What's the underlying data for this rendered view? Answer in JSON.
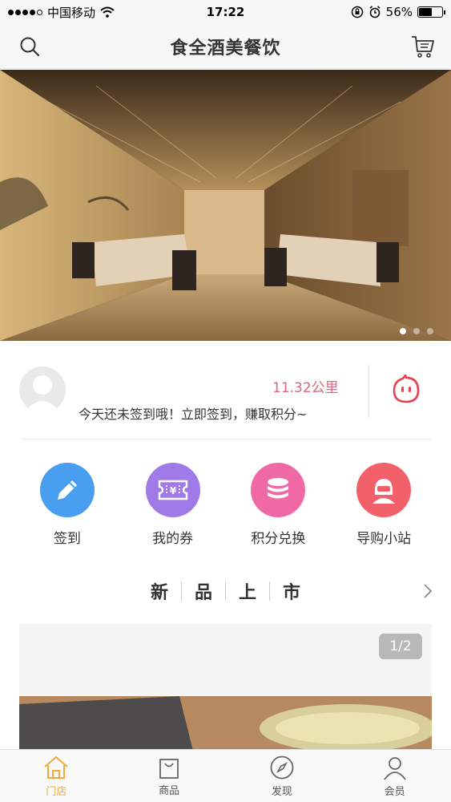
{
  "status_bar": {
    "carrier": "中国移动",
    "time": "17:22",
    "battery_text": "56%",
    "battery_level": 0.56
  },
  "nav": {
    "title": "食全酒美餐饮"
  },
  "banner": {
    "slide_count": 3,
    "active_slide": 0
  },
  "info": {
    "distance": "11.32公里",
    "signin_prompt": "今天还未签到哦！立即签到，赚取积分~"
  },
  "quick_menu": [
    {
      "label": "签到",
      "icon": "pencil-icon",
      "color": "#4a9ef0"
    },
    {
      "label": "我的券",
      "icon": "coupon-icon",
      "color": "#a07be8"
    },
    {
      "label": "积分兑换",
      "icon": "coins-icon",
      "color": "#ef6aa5"
    },
    {
      "label": "导购小站",
      "icon": "shopper-icon",
      "color": "#f2616a"
    }
  ],
  "section": {
    "title_chars": [
      "新",
      "品",
      "上",
      "市"
    ]
  },
  "product_card": {
    "pager": "1/2"
  },
  "tabs": [
    {
      "label": "门店",
      "icon": "house-icon",
      "active": true
    },
    {
      "label": "商品",
      "icon": "bag-icon",
      "active": false
    },
    {
      "label": "发现",
      "icon": "compass-icon",
      "active": false
    },
    {
      "label": "会员",
      "icon": "person-icon",
      "active": false
    }
  ],
  "colors": {
    "accent": "#f2a93b",
    "distance": "#e2637b",
    "mascot": "#e5404f"
  }
}
